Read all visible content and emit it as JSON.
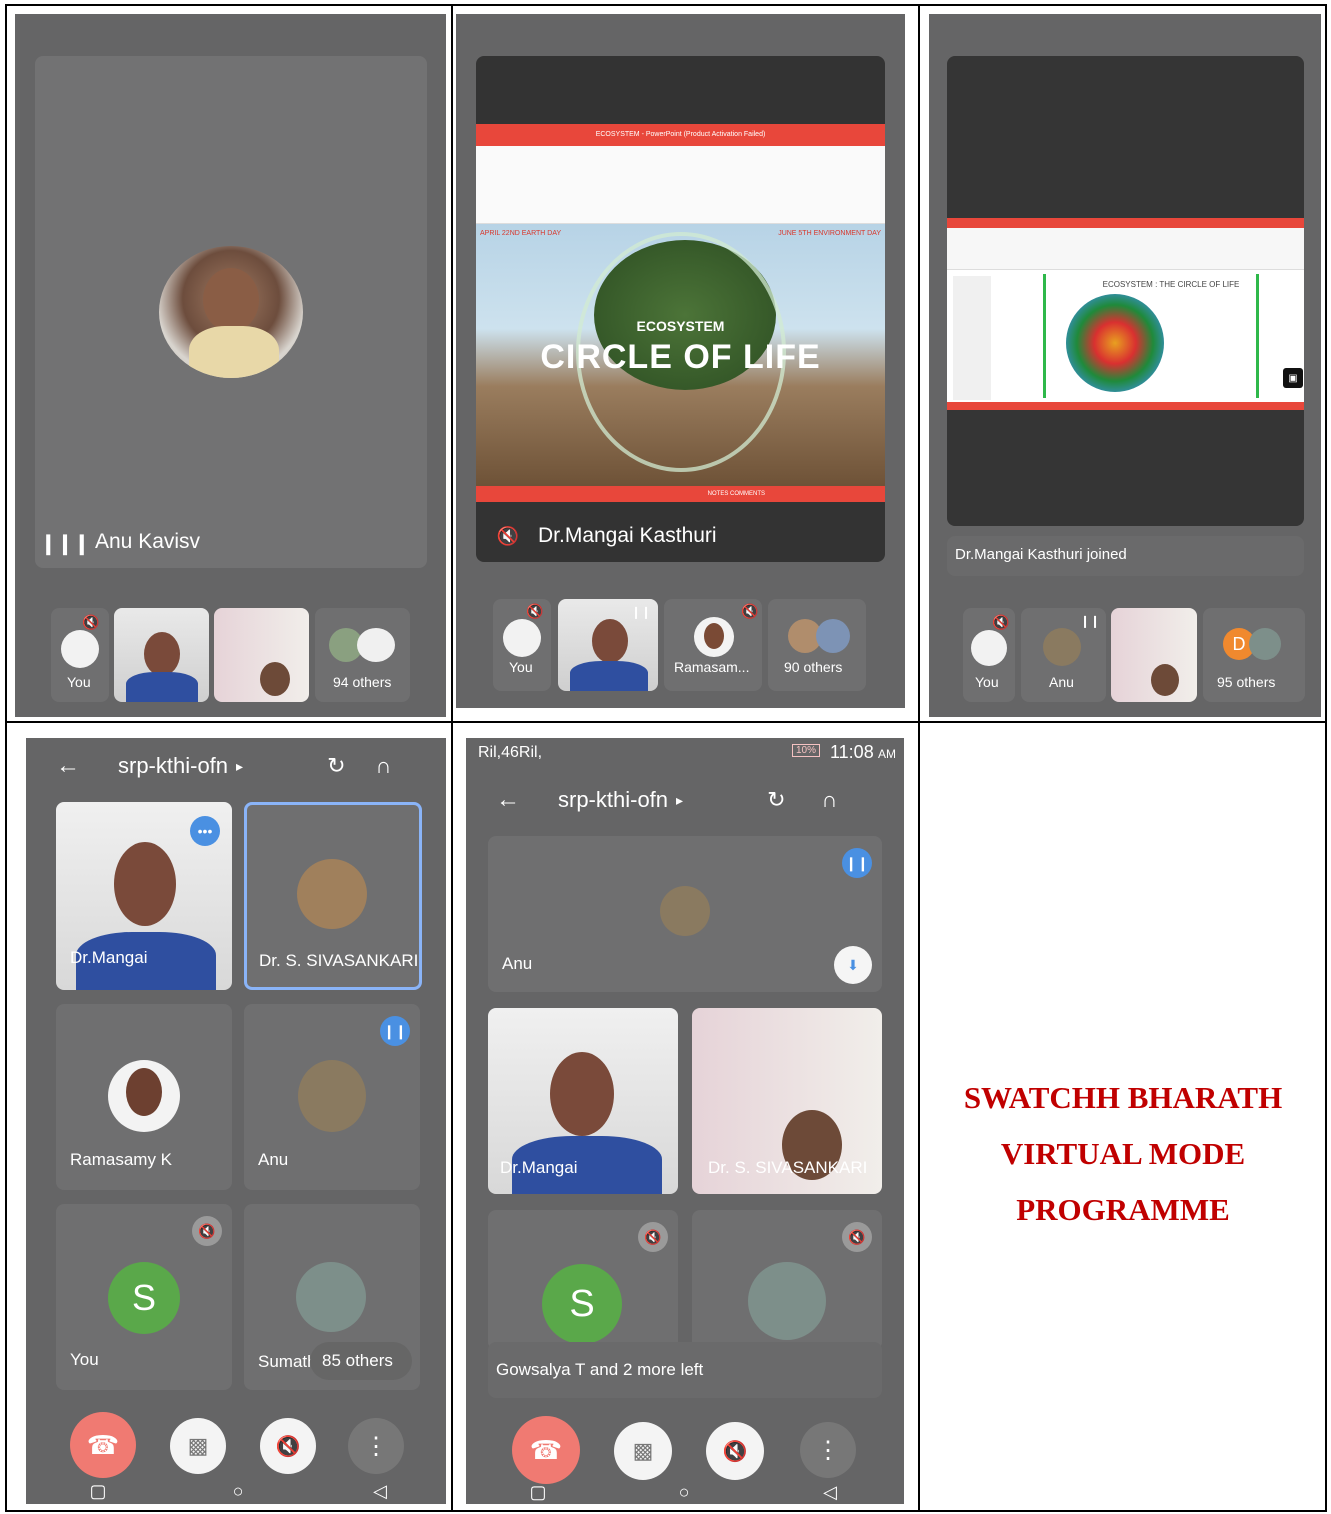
{
  "panel1": {
    "speaker": "Anu Kavisv",
    "thumbs": [
      {
        "label": "You"
      },
      {
        "label": ""
      },
      {
        "label": ""
      },
      {
        "label": "94 others"
      }
    ]
  },
  "panel2": {
    "speaker": "Dr.Mangai Kasthuri",
    "slide": {
      "titlebar": "ECOSYSTEM - PowerPoint (Product Activation Failed)",
      "left_caption": "APRIL 22ND EARTH DAY",
      "right_caption": "JUNE 5TH ENVIRONMENT DAY",
      "line1": "ECOSYSTEM",
      "line2": "CIRCLE OF LIFE",
      "status": "NOTES   COMMENTS"
    },
    "thumbs": [
      {
        "label": "You"
      },
      {
        "label": ""
      },
      {
        "label": "Ramasam..."
      },
      {
        "label": "90 others"
      }
    ]
  },
  "panel3": {
    "notice": "Dr.Mangai Kasthuri joined",
    "slide_title": "ECOSYSTEM : THE CIRCLE OF LIFE",
    "thumbs": [
      {
        "label": "You"
      },
      {
        "label": "Anu"
      },
      {
        "label": ""
      },
      {
        "label": "95 others",
        "badge": "D"
      }
    ]
  },
  "panel4": {
    "meeting_code": "srp-kthi-ofn",
    "tiles": [
      {
        "label": "Dr.Mangai"
      },
      {
        "label": "Dr. S. SIVASANKARI"
      },
      {
        "label": "Ramasamy K"
      },
      {
        "label": "Anu"
      },
      {
        "label": "You",
        "initial": "S"
      },
      {
        "label": "Sumath",
        "overlay": "85 others"
      }
    ]
  },
  "panel5": {
    "status_left": "Ril,46Ril,",
    "battery": "10%",
    "time": "11:08",
    "ampm": "AM",
    "meeting_code": "srp-kthi-ofn",
    "tiles": [
      {
        "label": "Anu"
      },
      {
        "label": "Dr.Mangai"
      },
      {
        "label": "Dr. S. SIVASANKARI"
      },
      {
        "label": "",
        "initial": "S"
      },
      {
        "label": ""
      }
    ],
    "notice": "Gowsalya T and 2 more left"
  },
  "banner": {
    "line1": "SWATCHH BHARATH",
    "line2": "VIRTUAL MODE",
    "line3": "PROGRAMME"
  },
  "colors": {
    "accent": "#4a90e2",
    "end_call": "#f07a72",
    "banner": "#c00000",
    "screen_bg": "#656566",
    "tile_bg": "#6f6f70"
  }
}
